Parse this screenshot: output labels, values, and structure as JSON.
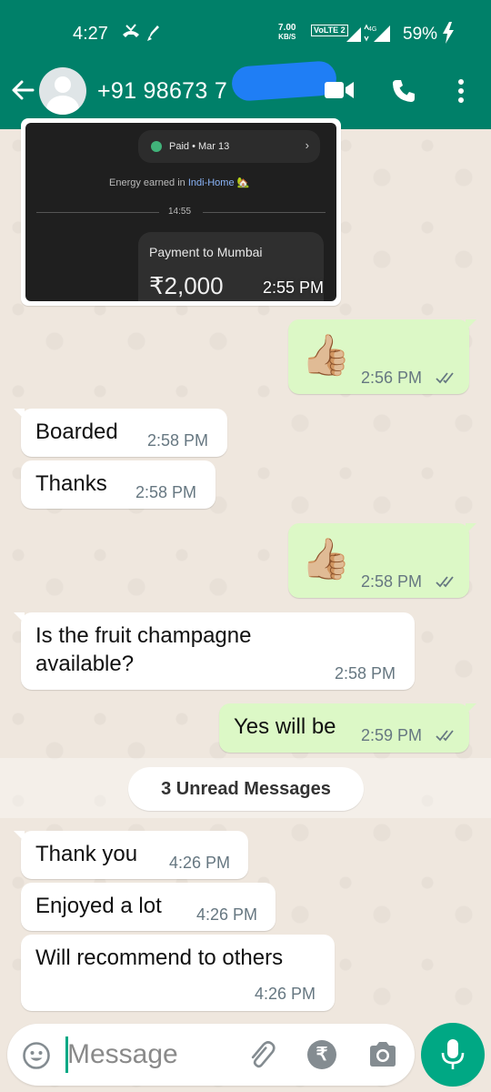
{
  "status_bar": {
    "time": "4:27",
    "net_speed_value": "7.00",
    "net_speed_unit": "KB/S",
    "volte": "VoLTE 2",
    "network_label": "4G",
    "battery": "59%"
  },
  "header": {
    "contact_name": "+91 98673 7",
    "icons": [
      "back-arrow-icon",
      "video-call-icon",
      "voice-call-icon",
      "more-options-icon"
    ]
  },
  "image_message": {
    "paid_label": "Paid • Mar 13",
    "energy_prefix": "Energy earned in ",
    "energy_link": "Indi-Home",
    "energy_emoji": "🏡",
    "divider_time": "14:55",
    "payment_label": "Payment to Mumbai",
    "payment_amount": "₹2,000",
    "time": "2:55 PM"
  },
  "messages": [
    {
      "dir": "out",
      "emoji": "👍🏼",
      "time": "2:56 PM"
    },
    {
      "dir": "in",
      "text": "Boarded",
      "time": "2:58 PM"
    },
    {
      "dir": "in",
      "text": "Thanks",
      "time": "2:58 PM"
    },
    {
      "dir": "out",
      "emoji": "👍🏼",
      "time": "2:58 PM"
    },
    {
      "dir": "in",
      "text_line1": "Is the fruit champagne",
      "text_line2": "available?",
      "time": "2:58 PM"
    },
    {
      "dir": "out",
      "text": "Yes will be",
      "time": "2:59 PM"
    },
    {
      "dir": "in",
      "text": "Thank you",
      "time": "4:26 PM"
    },
    {
      "dir": "in",
      "text": "Enjoyed a lot",
      "time": "4:26 PM"
    },
    {
      "dir": "in",
      "text": "Will recommend to others",
      "time": "4:26 PM"
    }
  ],
  "unread_banner": "3 Unread Messages",
  "composer": {
    "placeholder": "Message",
    "rupee_symbol": "₹"
  },
  "colors": {
    "header": "#008069",
    "outgoing_bubble": "#dcf8c6",
    "incoming_bubble": "#ffffff",
    "mic_button": "#00a884"
  }
}
